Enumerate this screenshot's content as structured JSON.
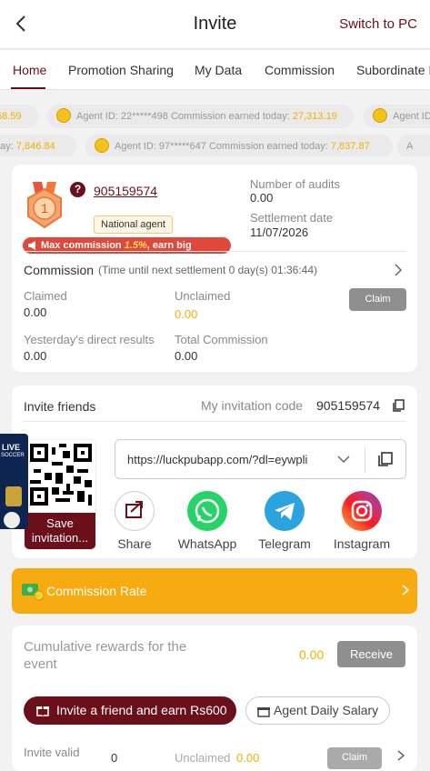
{
  "header": {
    "title": "Invite",
    "switch_label": "Switch to PC"
  },
  "tabs": [
    "Home",
    "Promotion Sharing",
    "My Data",
    "Commission",
    "Subordinate I"
  ],
  "ticker": {
    "row1": [
      {
        "prefix": "",
        "agent": "",
        "amount": "58.59"
      },
      {
        "prefix": "Agent ID: ",
        "agent": "22*****498",
        "earned_label": " Commission earned today: ",
        "amount": "27,313.19"
      },
      {
        "prefix": "Agent ID",
        "agent": "",
        "amount": ""
      }
    ],
    "row2": [
      {
        "prefix": "day: ",
        "agent": "",
        "amount": "7,846.84"
      },
      {
        "prefix": "Agent ID: ",
        "agent": "97*****647",
        "earned_label": " Commission earned today: ",
        "amount": "7,837.87"
      },
      {
        "prefix": "A",
        "agent": "",
        "amount": ""
      }
    ]
  },
  "agent_card": {
    "level": "1",
    "agent_id": "905159574",
    "agent_type": "National agent",
    "audits_label": "Number of audits",
    "audits_value": "0.00",
    "settlement_label": "Settlement date",
    "settlement_value": "11/07/2026",
    "max_prefix": "Max commission ",
    "max_pct": "1.5%",
    "max_suffix": ", earn big monthly",
    "commission_label": "Commission",
    "commission_sub": "(Time until next settlement  0 day(s) 01:36:44)",
    "claimed_label": "Claimed",
    "claimed_value": "0.00",
    "unclaimed_label": "Unclaimed",
    "unclaimed_value": "0.00",
    "claim_button": "Claim",
    "yesterday_label": "Yesterday's direct results",
    "yesterday_value": "0.00",
    "total_label": "Total Commission",
    "total_value": "0.00"
  },
  "invite": {
    "title": "Invite friends",
    "code_label": "My invitation code",
    "code_value": "905159574",
    "link": "https://luckpubapp.com/?dl=eywpli",
    "save_label": "Save invitation...",
    "soccer_live": "LIVE",
    "soccer_text": "SOCCER",
    "share": [
      {
        "label": "Share",
        "icon": "share-icon"
      },
      {
        "label": "WhatsApp",
        "icon": "whatsapp-icon"
      },
      {
        "label": "Telegram",
        "icon": "telegram-icon"
      },
      {
        "label": "Instagram",
        "icon": "instagram-icon"
      }
    ]
  },
  "rate": {
    "label": "Commission Rate"
  },
  "rewards": {
    "title": "Cumulative rewards for the event",
    "value": "0.00",
    "receive_button": "Receive",
    "invite_button": "Invite a friend and earn Rs600",
    "salary_button": "Agent Daily Salary",
    "valid_label": "Invite valid",
    "valid_value": "0",
    "unclaimed_label": "Unclaimed",
    "unclaimed_value": "0.00",
    "claim_button": "Claim"
  },
  "colors": {
    "brand": "#6b0f1a",
    "accent": "#f8ab10",
    "gold": "#f0b100"
  }
}
